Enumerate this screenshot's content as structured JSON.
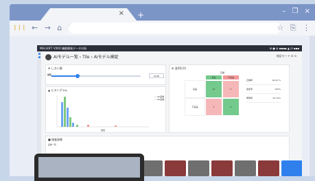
{
  "browser": {
    "new_tab": "+",
    "close_tab": "×",
    "window_controls": "– ❐ ×",
    "nav_icons": "← → ⌂ ↻",
    "right_icons": "☆ ⎘ ⋮"
  },
  "app": {
    "header_title": "MELSOFT VIXIO 機能開発データ分析",
    "header_right": "⊞ ● ⊕ ▪▪▪▪ ▲ ⊟ ▪▪▪",
    "breadcrumb": "AIモデル一覧 › Tile › AIモデル検証",
    "breadcrumb_right": "検証モード ⊞ ⊟",
    "threshold_title": "⊞ しきい値",
    "threshold_label": "閾値",
    "threshold_value": "10.00",
    "threshold_fraction": 0.29,
    "histogram_title": "▲ ヒストグラム",
    "histogram_xlabel": "閾値",
    "legend_items": [
      "— OK画像",
      "— NG画像"
    ],
    "matrix_title": "⊞ 混同行列",
    "matrix_col_header": "正解",
    "matrix_col_ok": "良品",
    "matrix_col_ng": "不良品",
    "matrix_row_ok": "良品",
    "matrix_row_ng": "不良品",
    "matrix_values": [
      "12",
      "0",
      "1",
      "5"
    ],
    "metrics": [
      {
        "k": "正解率",
        "v": "94.44 %"
      },
      {
        "k": "適合率",
        "v": "100%"
      },
      {
        "k": "再現率",
        "v": "92.31%"
      }
    ],
    "images_title": "■ 検査画像",
    "images_sub": "画像一覧"
  }
}
